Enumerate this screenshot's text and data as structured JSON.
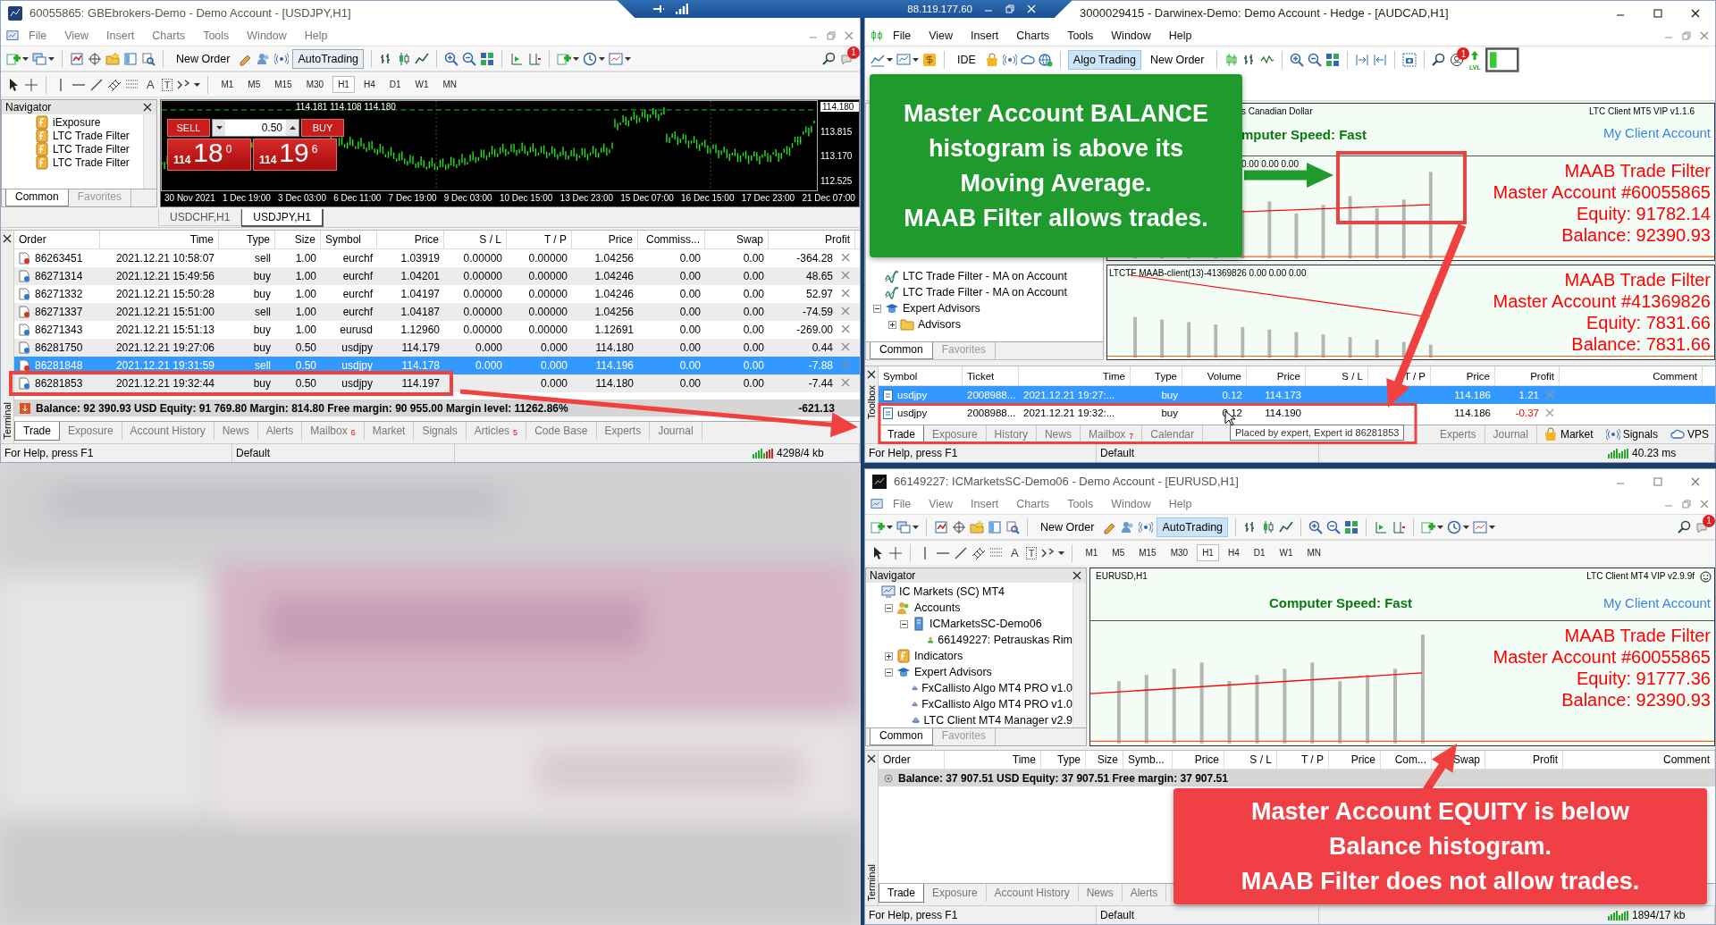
{
  "remote_bar": {
    "address": "88.119.177.60"
  },
  "left_window": {
    "title": "60055865: GBEbrokers-Demo - Demo Account - [USDJPY,H1]",
    "menu": [
      "File",
      "View",
      "Insert",
      "Charts",
      "Tools",
      "Window",
      "Help"
    ],
    "toolbar": [
      {
        "label": "New Order",
        "pressed": false
      },
      {
        "label": "AutoTrading",
        "pressed": true
      }
    ],
    "notification_count": "1",
    "drawing_tools": [
      "A",
      "T"
    ],
    "timeframes": [
      {
        "label": "M1",
        "selected": false
      },
      {
        "label": "M5",
        "selected": false
      },
      {
        "label": "M15",
        "selected": false
      },
      {
        "label": "M30",
        "selected": false
      },
      {
        "label": "H1",
        "selected": true
      },
      {
        "label": "H4",
        "selected": false
      },
      {
        "label": "D1",
        "selected": false
      },
      {
        "label": "W1",
        "selected": false
      },
      {
        "label": "MN",
        "selected": false
      }
    ],
    "navigator": {
      "title": "Navigator",
      "items": [
        {
          "label": "iExposure",
          "kind": "indicator"
        },
        {
          "label": "LTC Trade Filter",
          "kind": "indicator"
        },
        {
          "label": "LTC Trade Filter",
          "kind": "indicator"
        },
        {
          "label": "LTC Trade Filter",
          "kind": "indicator"
        }
      ],
      "tabs": [
        {
          "label": "Common",
          "selected": true
        },
        {
          "label": "Favorites",
          "selected": false
        }
      ]
    },
    "chart": {
      "ohlc": "114.181 114.108 114.180",
      "sell": {
        "label": "SELL",
        "big": "114",
        "figure": "18",
        "pip": "0"
      },
      "buy": {
        "label": "BUY",
        "big": "114",
        "figure": "19",
        "pip": "6"
      },
      "lot": "0.50",
      "price_axis": [
        "114.180",
        "113.815",
        "113.170",
        "112.525"
      ],
      "time_axis": [
        "30 Nov 2021",
        "1 Dec 19:00",
        "3 Dec 03:00",
        "6 Dec 11:00",
        "7 Dec 19:00",
        "9 Dec 03:00",
        "10 Dec 15:00",
        "13 Dec 23:00",
        "15 Dec 07:00",
        "16 Dec 15:00",
        "17 Dec 23:00",
        "21 Dec 07:00"
      ]
    },
    "chart_tabs": [
      {
        "label": "USDCHF,H1",
        "selected": false
      },
      {
        "label": "USDJPY,H1",
        "selected": true
      }
    ],
    "terminal": {
      "side_label": "Terminal",
      "columns": [
        "Order",
        "Time",
        "Type",
        "Size",
        "Symbol",
        "Price",
        "S / L",
        "T / P",
        "Price",
        "Commiss...",
        "Swap",
        "Profit"
      ],
      "rows": [
        {
          "kind": "sell",
          "selected": false,
          "cells": [
            "86263451",
            "2021.12.21 10:58:07",
            "sell",
            "1.00",
            "eurchf",
            "1.03919",
            "0.00000",
            "0.00000",
            "1.04256",
            "0.00",
            "0.00",
            "-364.28"
          ]
        },
        {
          "kind": "buy",
          "selected": false,
          "cells": [
            "86271314",
            "2021.12.21 15:49:56",
            "buy",
            "1.00",
            "eurchf",
            "1.04201",
            "0.00000",
            "0.00000",
            "1.04246",
            "0.00",
            "0.00",
            "48.65"
          ]
        },
        {
          "kind": "buy",
          "selected": false,
          "cells": [
            "86271332",
            "2021.12.21 15:50:28",
            "buy",
            "1.00",
            "eurchf",
            "1.04197",
            "0.00000",
            "0.00000",
            "1.04246",
            "0.00",
            "0.00",
            "52.97"
          ]
        },
        {
          "kind": "sell",
          "selected": false,
          "cells": [
            "86271337",
            "2021.12.21 15:51:00",
            "sell",
            "1.00",
            "eurchf",
            "1.04187",
            "0.00000",
            "0.00000",
            "1.04256",
            "0.00",
            "0.00",
            "-74.59"
          ]
        },
        {
          "kind": "buy",
          "selected": false,
          "cells": [
            "86271343",
            "2021.12.21 15:51:13",
            "buy",
            "1.00",
            "eurusd",
            "1.12960",
            "0.00000",
            "0.00000",
            "1.12691",
            "0.00",
            "0.00",
            "-269.00"
          ]
        },
        {
          "kind": "buy",
          "selected": false,
          "cells": [
            "86281750",
            "2021.12.21 19:27:06",
            "buy",
            "0.50",
            "usdjpy",
            "114.179",
            "0.000",
            "0.000",
            "114.180",
            "0.00",
            "0.00",
            "0.44"
          ]
        },
        {
          "kind": "sell",
          "selected": true,
          "cells": [
            "86281848",
            "2021.12.21 19:31:59",
            "sell",
            "0.50",
            "usdjpy",
            "114.178",
            "0.000",
            "0.000",
            "114.196",
            "0.00",
            "0.00",
            "-7.88"
          ]
        },
        {
          "kind": "buy",
          "selected": false,
          "cells": [
            "86281853",
            "2021.12.21 19:32:44",
            "buy",
            "0.50",
            "usdjpy",
            "114.197",
            null,
            "0.000",
            "114.180",
            "0.00",
            "0.00",
            "-7.44"
          ]
        }
      ],
      "balance": "Balance: 92 390.93 USD  Equity: 91 769.80  Margin: 814.80  Free margin: 90 955.00  Margin level: 11262.86%",
      "total": "-621.13",
      "tabs": [
        {
          "label": "Trade",
          "selected": true
        },
        {
          "label": "Exposure",
          "selected": false
        },
        {
          "label": "Account History",
          "selected": false
        },
        {
          "label": "News",
          "selected": false
        },
        {
          "label": "Alerts",
          "selected": false
        },
        {
          "label": "Mailbox",
          "badge": "6",
          "selected": false
        },
        {
          "label": "Market",
          "selected": false
        },
        {
          "label": "Signals",
          "selected": false
        },
        {
          "label": "Articles",
          "badge": "5",
          "selected": false
        },
        {
          "label": "Code Base",
          "selected": false
        },
        {
          "label": "Experts",
          "selected": false
        },
        {
          "label": "Journal",
          "selected": false
        }
      ]
    },
    "status_bar": [
      "For Help, press F1",
      "Default",
      "4298/4 kb"
    ]
  },
  "right_window": {
    "title": "3000029415 - Darwinex-Demo: Demo Account - Hedge - [AUDCAD,H1]",
    "menu": [
      "File",
      "View",
      "Insert",
      "Charts",
      "Tools",
      "Window",
      "Help"
    ],
    "toolbar": [
      {
        "label": "IDE",
        "pressed": false
      },
      {
        "label": "Algo Trading",
        "pressed": true
      },
      {
        "label": "New Order",
        "pressed": false
      }
    ],
    "notification_count": "1",
    "level_label": "LVL",
    "navigator": {
      "items": [
        {
          "label": "LTC Trade Filter - MA on Account",
          "kind": "ma"
        },
        {
          "label": "LTC Trade Filter - MA on Account",
          "kind": "ma"
        },
        {
          "label": "Expert Advisors",
          "kind": "experts",
          "expanded": true,
          "children": [
            {
              "label": "Advisors",
              "kind": "folder",
              "expanded": false
            }
          ]
        }
      ],
      "tabs": [
        {
          "label": "Common",
          "selected": true
        },
        {
          "label": "Favorites",
          "selected": false
        }
      ]
    },
    "charts": [
      {
        "info": {
          "symbol_name": "s Canadian Dollar",
          "product": "LTC Client MT5 VIP v1.1.6",
          "speed": "mputer Speed: Fast",
          "link": "My Client Account"
        },
        "indicator": "0.00 0.00 0.00",
        "filter": [
          "MAAB Trade Filter",
          "Master Account #60055865",
          "Equity: 91782.14",
          "Balance: 92390.93"
        ]
      },
      {
        "indicator": "LTCTF MAAB-client(13)-41369826 0.00 0.00 0.00",
        "filter": [
          "MAAB Trade Filter",
          "Master Account #41369826",
          "Equity: 7831.66",
          "Balance: 7831.66"
        ]
      }
    ],
    "terminal": {
      "side_label": "Toolbox",
      "columns": [
        "Symbol",
        "Ticket",
        "Time",
        "Type",
        "Volume",
        "Price",
        "S / L",
        "T / P",
        "Price",
        "Profit",
        "Comment"
      ],
      "rows": [
        {
          "selected": true,
          "loss": false,
          "cells": [
            "usdjpy",
            "2008988...",
            "2021.12.21 19:27:...",
            "buy",
            "0.12",
            "114.173",
            null,
            null,
            "114.186",
            "1.21",
            null
          ]
        },
        {
          "selected": false,
          "loss": true,
          "cells": [
            "usdjpy",
            "2008988...",
            "2021.12.21 19:32:...",
            "buy",
            "0.12",
            "114.190",
            null,
            null,
            "114.186",
            "-0.37",
            null
          ]
        }
      ],
      "tabs": [
        {
          "label": "Trade",
          "selected": true
        },
        {
          "label": "Exposure",
          "selected": false
        },
        {
          "label": "History",
          "selected": false
        },
        {
          "label": "News",
          "selected": false
        },
        {
          "label": "Mailbox",
          "badge": "7",
          "selected": false
        },
        {
          "label": "Calendar",
          "selected": false
        }
      ],
      "right_tabs": [
        {
          "label": "Experts",
          "selected": false
        },
        {
          "label": "Journal",
          "selected": false
        }
      ],
      "extra_tabs": [
        {
          "label": "Market",
          "kind": "bag"
        },
        {
          "label": "Signals",
          "kind": "signal"
        },
        {
          "label": "VPS",
          "kind": "cloud"
        }
      ],
      "tooltip": "Placed by expert, Expert id 86281853"
    },
    "status_bar": [
      "For Help, press F1",
      "Default",
      "40.23 ms"
    ]
  },
  "lower_window": {
    "title": "66149227: ICMarketsSC-Demo06 - Demo Account - [EURUSD,H1]",
    "menu": [
      "File",
      "View",
      "Insert",
      "Charts",
      "Tools",
      "Window",
      "Help"
    ],
    "toolbar": [
      {
        "label": "New Order",
        "pressed": false
      },
      {
        "label": "AutoTrading",
        "pressed": true
      }
    ],
    "notification_count": "1",
    "drawing_tools": [
      "A",
      "T"
    ],
    "timeframes": [
      {
        "label": "M1",
        "selected": false
      },
      {
        "label": "M5",
        "selected": false
      },
      {
        "label": "M15",
        "selected": false
      },
      {
        "label": "M30",
        "selected": false
      },
      {
        "label": "H1",
        "selected": true
      },
      {
        "label": "H4",
        "selected": false
      },
      {
        "label": "D1",
        "selected": false
      },
      {
        "label": "W1",
        "selected": false
      },
      {
        "label": "MN",
        "selected": false
      }
    ],
    "navigator": {
      "title": "Navigator",
      "items": [
        {
          "label": "IC Markets (SC) MT4",
          "kind": "terminal",
          "children": [
            {
              "label": "Accounts",
              "kind": "accounts",
              "expanded": true,
              "children": [
                {
                  "label": "ICMarketsSC-Demo06",
                  "kind": "server",
                  "expanded": true,
                  "children": [
                    {
                      "label": "66149227: Petrauskas Rim",
                      "kind": "user"
                    }
                  ]
                }
              ]
            },
            {
              "label": "Indicators",
              "kind": "indicator",
              "expanded": false
            },
            {
              "label": "Expert Advisors",
              "kind": "experts",
              "expanded": true,
              "children": [
                {
                  "label": "FxCallisto Algo MT4 PRO v1.0",
                  "kind": "expert"
                },
                {
                  "label": "FxCallisto Algo MT4 PRO v1.0",
                  "kind": "expert"
                },
                {
                  "label": "LTC Client MT4 Manager v2.9",
                  "kind": "expert"
                }
              ]
            }
          ]
        }
      ],
      "tabs": [
        {
          "label": "Common",
          "selected": true
        },
        {
          "label": "Favorites",
          "selected": false
        }
      ]
    },
    "chart": {
      "info": {
        "symbol_name": "EURUSD,H1",
        "product": "LTC Client MT4 VIP v2.9.9f",
        "speed": "Computer Speed: Fast",
        "link": "My Client Account"
      },
      "filter": [
        "MAAB Trade Filter",
        "Master Account #60055865",
        "Equity: 91777.36",
        "Balance: 92390.93"
      ]
    },
    "terminal": {
      "side_label": "Terminal",
      "columns": [
        "Order",
        "Time",
        "Type",
        "Size",
        "Symb...",
        "Price",
        "S / L",
        "T / P",
        "Price",
        "Com...",
        "Swap",
        "Profit",
        "Comment"
      ],
      "balance": "Balance: 37 907.51 USD  Equity: 37 907.51  Free margin: 37 907.51",
      "tabs": [
        {
          "label": "Trade",
          "selected": true
        },
        {
          "label": "Exposure",
          "selected": false
        },
        {
          "label": "Account History",
          "selected": false
        },
        {
          "label": "News",
          "selected": false
        },
        {
          "label": "Alerts",
          "selected": false
        }
      ]
    },
    "status_bar": [
      "For Help, press F1",
      "Default",
      "1894/17 kb"
    ]
  },
  "callouts": [
    {
      "kind": "allow",
      "text": "Master Account BALANCE\nhistogram is above its\nMoving Average.\nMAAB Filter allows trades."
    },
    {
      "kind": "deny",
      "text": "Master Account EQUITY is below\nBalance histogram.\nMAAB Filter does not allow trades."
    }
  ]
}
